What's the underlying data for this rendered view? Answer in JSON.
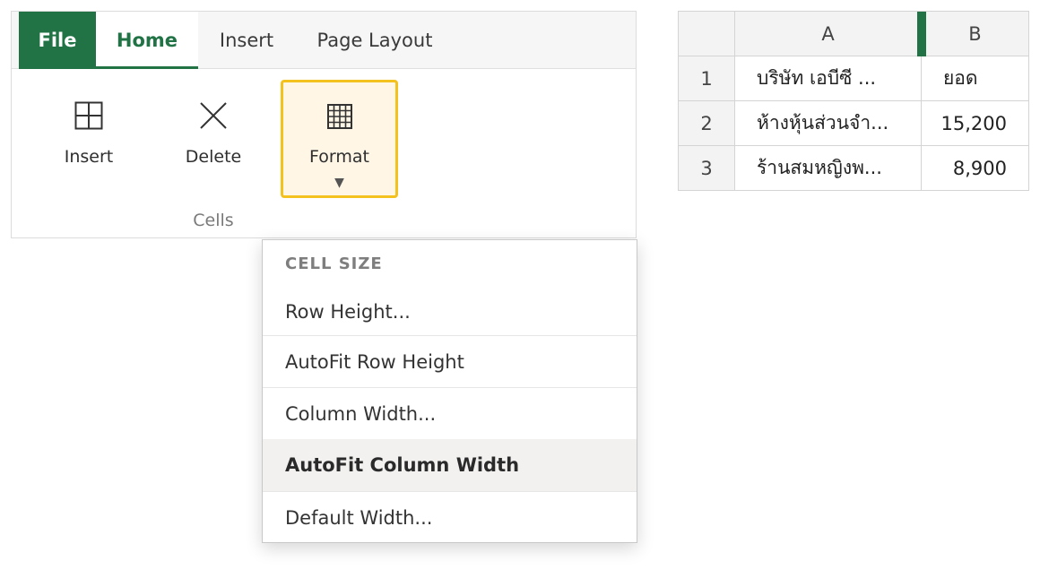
{
  "ribbon": {
    "tabs": {
      "file": "File",
      "home": "Home",
      "insert": "Insert",
      "page_layout": "Page Layout"
    },
    "buttons": {
      "insert": {
        "label": "Insert",
        "icon": "insert-cells-icon"
      },
      "delete": {
        "label": "Delete",
        "icon": "close-icon"
      },
      "format": {
        "label": "Format",
        "icon": "format-grid-icon",
        "caret": "▼"
      }
    },
    "group_label": "Cells",
    "accent_color": "#217346",
    "highlight_color": "#f4c21f"
  },
  "format_menu": {
    "header": "CELL SIZE",
    "items": [
      {
        "label": "Row Height..."
      },
      {
        "label": "AutoFit Row Height"
      },
      {
        "label": "Column Width..."
      },
      {
        "label": "AutoFit Column Width"
      },
      {
        "label": "Default Width..."
      }
    ],
    "active_item": "AutoFit Column Width"
  },
  "sheet": {
    "columns": [
      "A",
      "B"
    ],
    "rows": [
      {
        "num": "1",
        "a": "บริษัท เอบีซี ...",
        "b": "ยอด"
      },
      {
        "num": "2",
        "a": "ห้างหุ้นส่วนจำ...",
        "b": "15,200"
      },
      {
        "num": "3",
        "a": "ร้านสมหญิงพ...",
        "b": "8,900"
      }
    ]
  }
}
